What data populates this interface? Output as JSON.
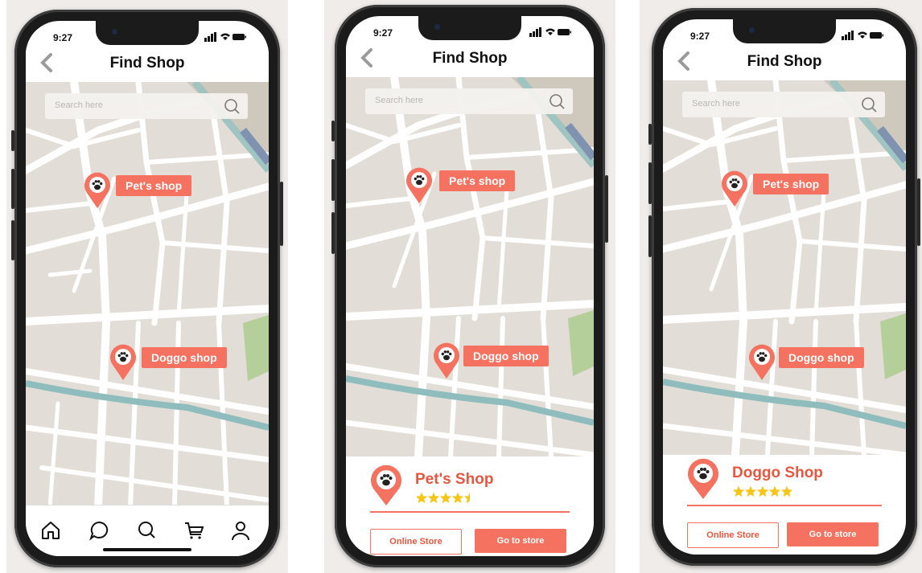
{
  "colors": {
    "accent": "#f4725f",
    "accent_text": "#e8563e",
    "star": "#f5c518",
    "map_bg": "#e2ddd6"
  },
  "screens": [
    {
      "status_time": "9:27",
      "title": "Find Shop",
      "search_placeholder": "Search here",
      "pins": [
        {
          "label": "Pet's shop",
          "icon": "paw-icon"
        },
        {
          "label": "Doggo shop",
          "icon": "paw-icon"
        }
      ],
      "bottom_nav": [
        {
          "icon": "home-icon"
        },
        {
          "icon": "chat-icon"
        },
        {
          "icon": "search-icon"
        },
        {
          "icon": "cart-icon"
        },
        {
          "icon": "profile-icon"
        }
      ]
    },
    {
      "status_time": "9:27",
      "title": "Find Shop",
      "search_placeholder": "Search here",
      "pins": [
        {
          "label": "Pet's shop",
          "icon": "paw-icon"
        },
        {
          "label": "Doggo shop",
          "icon": "paw-icon"
        }
      ],
      "card": {
        "name": "Pet's Shop",
        "rating": 4.5,
        "online_store": "Online Store",
        "go_to_store": "Go to store"
      }
    },
    {
      "status_time": "9:27",
      "title": "Find Shop",
      "search_placeholder": "Search here",
      "pins": [
        {
          "label": "Pet's shop",
          "icon": "paw-icon"
        },
        {
          "label": "Doggo shop",
          "icon": "paw-icon"
        }
      ],
      "card": {
        "name": "Doggo Shop",
        "rating": 5,
        "online_store": "Online Store",
        "go_to_store": "Go to store"
      }
    }
  ]
}
